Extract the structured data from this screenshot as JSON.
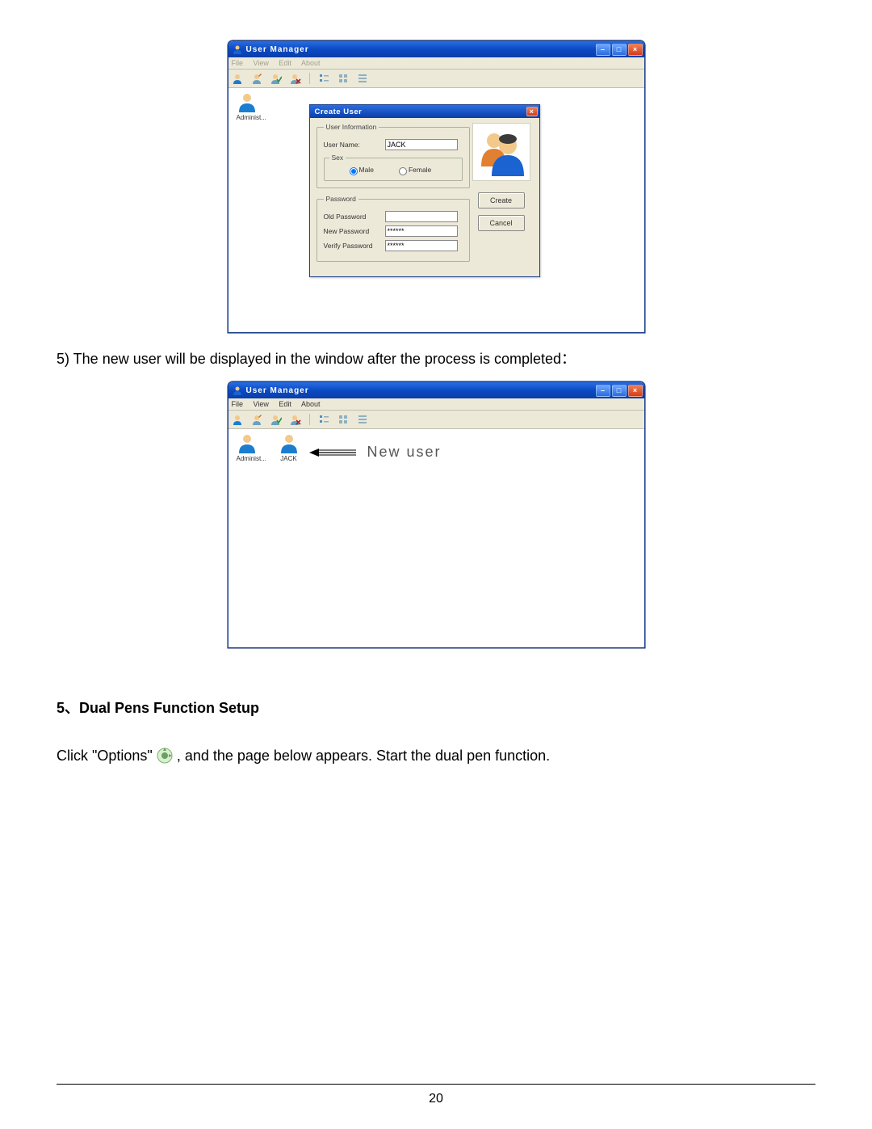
{
  "win1": {
    "title": "User Manager",
    "menu_file": "File",
    "menu_view": "View",
    "menu_edit": "Edit",
    "menu_about": "About",
    "user1_label": "Administ..."
  },
  "dialog": {
    "title": "Create User",
    "fs_userinfo": "User Information",
    "lbl_username": "User Name:",
    "val_username": "JACK",
    "fs_sex": "Sex",
    "opt_male": "Male",
    "opt_female": "Female",
    "fs_password": "Password",
    "lbl_oldpw": "Old Password",
    "lbl_newpw": "New Password",
    "val_newpw": "******",
    "lbl_verifypw": "Verify Password",
    "val_verifypw": "******",
    "btn_create": "Create",
    "btn_cancel": "Cancel"
  },
  "text_step5": "5) The new user will be displayed in the window after the process is completed：",
  "win2": {
    "title": "User Manager",
    "menu_file": "File",
    "menu_view": "View",
    "menu_edit": "Edit",
    "menu_about": "About",
    "user1_label": "Administ...",
    "user2_label": "JACK",
    "annotation": "New user"
  },
  "heading": "5、Dual Pens Function Setup",
  "text_options_a": "Click \"Options\"",
  "text_options_b": ", and the page below appears.  Start the dual pen function.",
  "page_number": "20"
}
